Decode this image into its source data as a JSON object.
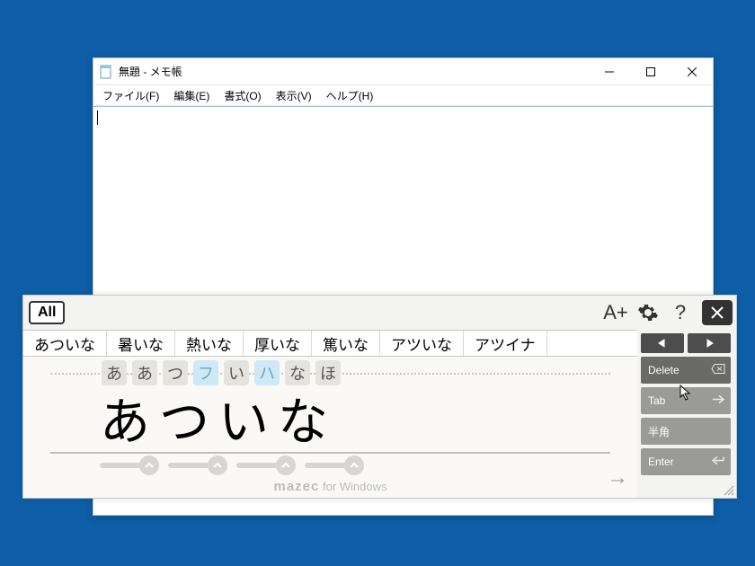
{
  "notepad": {
    "title": "無題 - メモ帳",
    "menus": [
      "ファイル(F)",
      "編集(E)",
      "書式(O)",
      "表示(V)",
      "ヘルプ(H)"
    ]
  },
  "ime": {
    "mode": "All",
    "font_size_label": "A+",
    "candidates": [
      "あついな",
      "暑いな",
      "熱いな",
      "厚いな",
      "篤いな",
      "アツいな",
      "アツイナ"
    ],
    "kana_tokens": [
      {
        "t": "あ",
        "alt": false
      },
      {
        "t": "あ",
        "alt": false
      },
      {
        "t": "つ",
        "alt": false
      },
      {
        "t": "フ",
        "alt": true
      },
      {
        "t": "い",
        "alt": false
      },
      {
        "t": "ハ",
        "alt": true
      },
      {
        "t": "な",
        "alt": false
      },
      {
        "t": "ほ",
        "alt": false
      }
    ],
    "handwriting": "あついな",
    "brand": "mazec",
    "brand_sub": " for Windows",
    "keys": {
      "delete": "Delete",
      "tab": "Tab",
      "hankaku": "半角",
      "enter": "Enter"
    }
  }
}
